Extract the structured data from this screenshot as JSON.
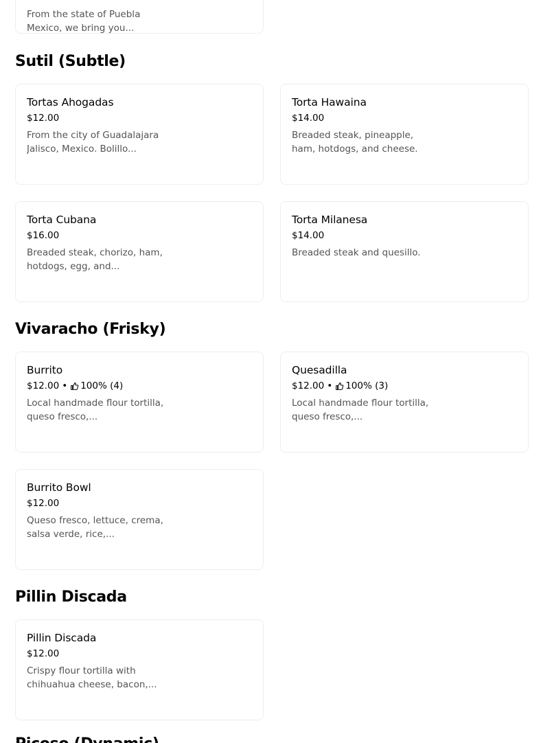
{
  "top_card": {
    "desc_line1": "From the state of Puebla",
    "desc_line2": "Mexico, we bring you..."
  },
  "sections": [
    {
      "title": "Sutil (Subtle)",
      "items": [
        {
          "name": "Tortas Ahogadas",
          "price": "$12.00",
          "desc": "From the city of Guadalajara Jalisco, Mexico. Bolillo..."
        },
        {
          "name": "Torta Hawaina",
          "price": "$14.00",
          "desc": "Breaded steak, pineapple, ham, hotdogs, and cheese."
        },
        {
          "name": "Torta Cubana",
          "price": "$16.00",
          "desc": "Breaded steak, chorizo, ham, hotdogs, egg, and..."
        },
        {
          "name": "Torta Milanesa",
          "price": "$14.00",
          "desc": "Breaded steak and quesillo."
        }
      ]
    },
    {
      "title": "Vivaracho (Frisky)",
      "items": [
        {
          "name": "Burrito",
          "price": "$12.00",
          "rating": "100% (4)",
          "desc": "Local handmade flour tortilla, queso fresco,..."
        },
        {
          "name": "Quesadilla",
          "price": "$12.00",
          "rating": "100% (3)",
          "desc": "Local handmade flour tortilla, queso fresco,..."
        },
        {
          "name": "Burrito Bowl",
          "price": "$12.00",
          "desc": "Queso fresco, lettuce, crema, salsa verde, rice,..."
        }
      ]
    },
    {
      "title": "Pillin Discada",
      "items": [
        {
          "name": "Pillin Discada",
          "price": "$12.00",
          "desc": "Crispy flour tortilla with chihuahua cheese, bacon,..."
        }
      ]
    },
    {
      "title": "Picoso (Dynamic)"
    }
  ],
  "separator": "•",
  "icons": {
    "rating": "thumbs-up-icon"
  }
}
